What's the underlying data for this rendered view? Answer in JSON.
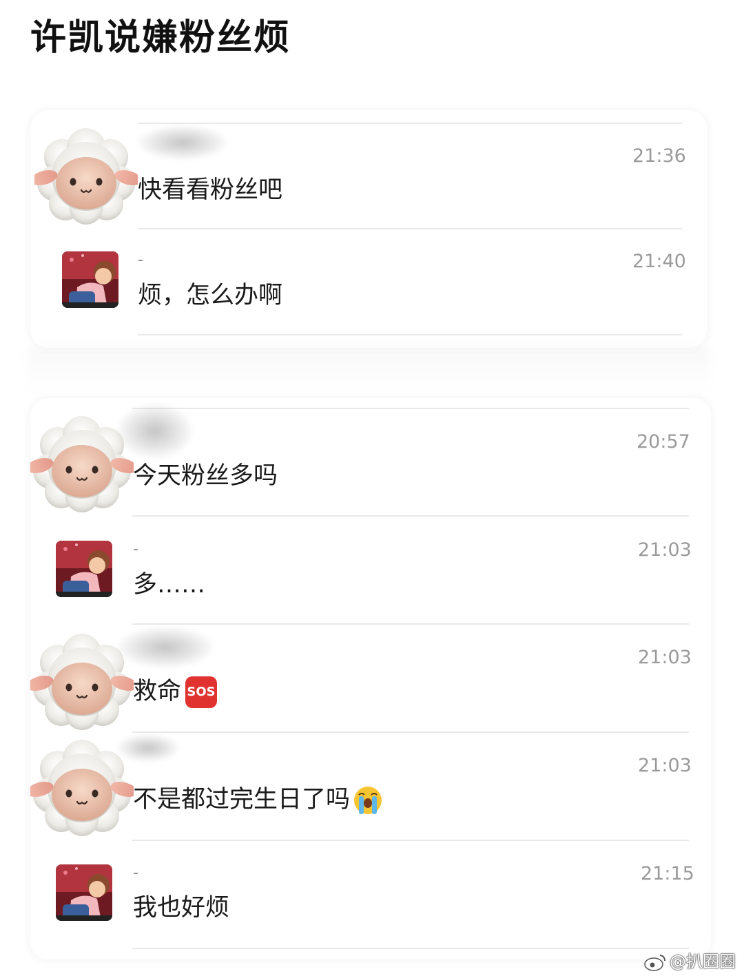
{
  "page": {
    "title": "许凯说嫌粉丝烦"
  },
  "conversation1": [
    {
      "sender": "sheep",
      "name": "",
      "time": "21:36",
      "text": "快看看粉丝吧"
    },
    {
      "sender": "boy",
      "name": "-",
      "time": "21:40",
      "text": "烦，怎么办啊"
    }
  ],
  "conversation2": [
    {
      "sender": "sheep",
      "name": "",
      "time": "20:57",
      "text": "今天粉丝多吗"
    },
    {
      "sender": "boy",
      "name": "-",
      "time": "21:03",
      "text": "多……"
    },
    {
      "sender": "sheep",
      "name": "",
      "time": "21:03",
      "text": "救命",
      "emoji": "SOS",
      "emoji_icon": "sos-button-icon"
    },
    {
      "sender": "sheep",
      "name": "",
      "time": "21:03",
      "text": "不是都过完生日了吗",
      "emoji_icon": "loudly-crying-face-icon"
    },
    {
      "sender": "boy",
      "name": "-",
      "time": "21:15",
      "text": "我也好烦"
    }
  ],
  "watermark": {
    "text": "@扒圈圈",
    "icon": "weibo-logo-icon"
  },
  "colors": {
    "time": "#9a9a9a",
    "divider": "#e9e9e9",
    "sos": "#e0322f"
  }
}
